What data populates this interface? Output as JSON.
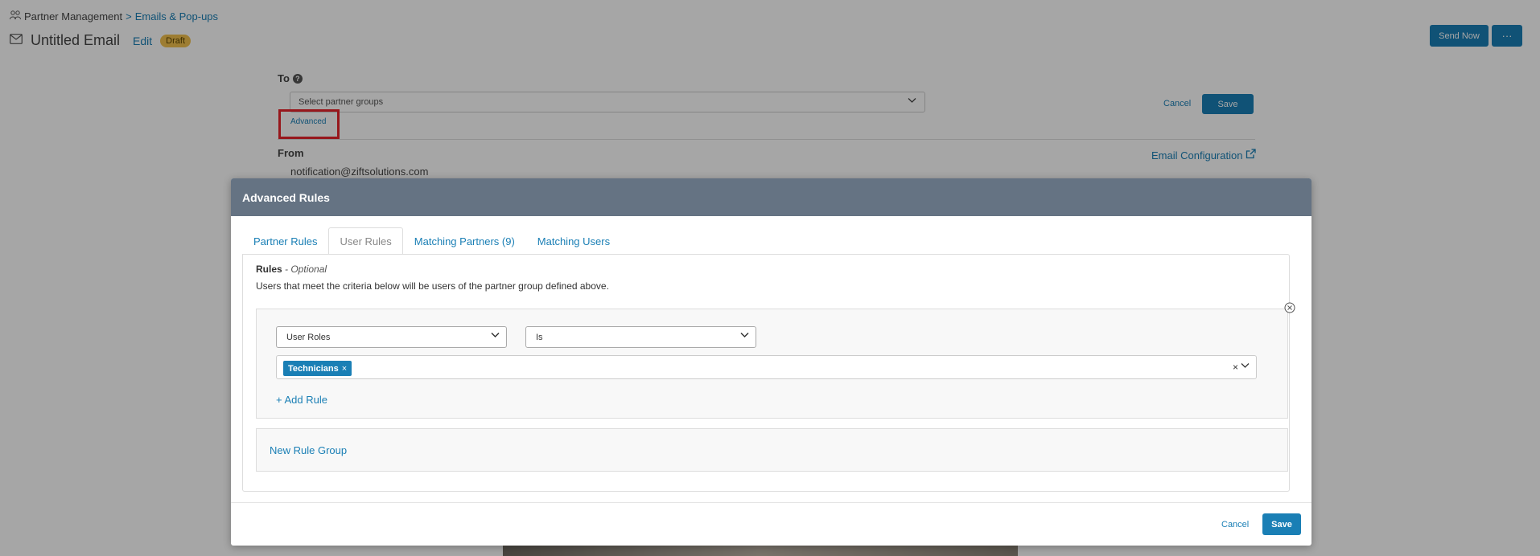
{
  "breadcrumb": {
    "parent": "Partner Management",
    "separator": ">",
    "current": "Emails & Pop-ups"
  },
  "header": {
    "title": "Untitled Email",
    "edit_label": "Edit",
    "status": "Draft",
    "send_now_label": "Send Now",
    "more_label": "···"
  },
  "to_section": {
    "label": "To",
    "select_placeholder": "Select partner groups",
    "advanced_label": "Advanced",
    "cancel_label": "Cancel",
    "save_label": "Save"
  },
  "from_section": {
    "label": "From",
    "value": "notification@ziftsolutions.com",
    "config_link": "Email Configuration"
  },
  "modal": {
    "title": "Advanced Rules",
    "tabs": [
      {
        "label": "Partner Rules",
        "active": false
      },
      {
        "label": "User Rules",
        "active": true
      },
      {
        "label": "Matching Partners (9)",
        "active": false
      },
      {
        "label": "Matching Users",
        "active": false
      }
    ],
    "rules_title": "Rules",
    "rules_optional": " - Optional",
    "rules_description": "Users that meet the criteria below will be users of the partner group defined above.",
    "rule": {
      "field": "User Roles",
      "operator": "Is",
      "values": [
        "Technicians"
      ]
    },
    "add_rule_label": "+ Add Rule",
    "new_rule_group_label": "New Rule Group",
    "cancel_label": "Cancel",
    "save_label": "Save"
  },
  "colors": {
    "accent": "#1a7fb5",
    "modal_header": "#657383",
    "highlight_box": "#e8242c",
    "draft_badge": "#f2c14e"
  }
}
